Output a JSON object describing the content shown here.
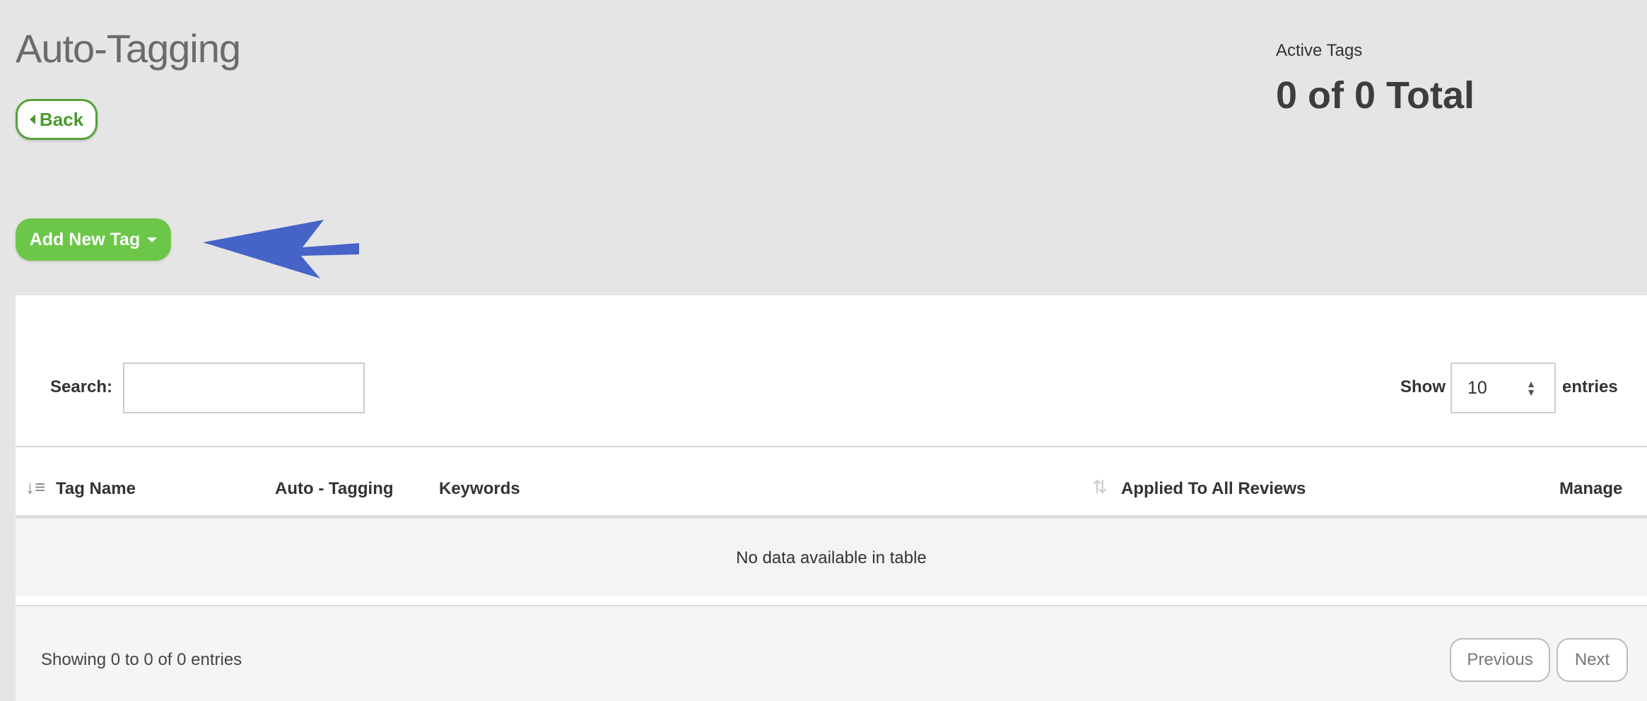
{
  "header": {
    "title": "Auto-Tagging",
    "back_label": "Back",
    "active_tags_label": "Active Tags",
    "active_tags_value": "0 of 0 Total"
  },
  "toolbar": {
    "add_new_tag_label": "Add New Tag"
  },
  "table": {
    "search_label": "Search:",
    "search_value": "",
    "show_label": "Show",
    "page_size": "10",
    "entries_label": "entries",
    "columns": [
      "Tag Name",
      "Auto - Tagging",
      "Keywords",
      "Applied To All Reviews",
      "Manage"
    ],
    "empty_message": "No data available in table",
    "info": "Showing 0 to 0 of 0 entries",
    "previous_label": "Previous",
    "next_label": "Next"
  },
  "colors": {
    "accent_green": "#6cc748",
    "back_green": "#4a9a2e",
    "annotation_arrow": "#4663c8"
  }
}
